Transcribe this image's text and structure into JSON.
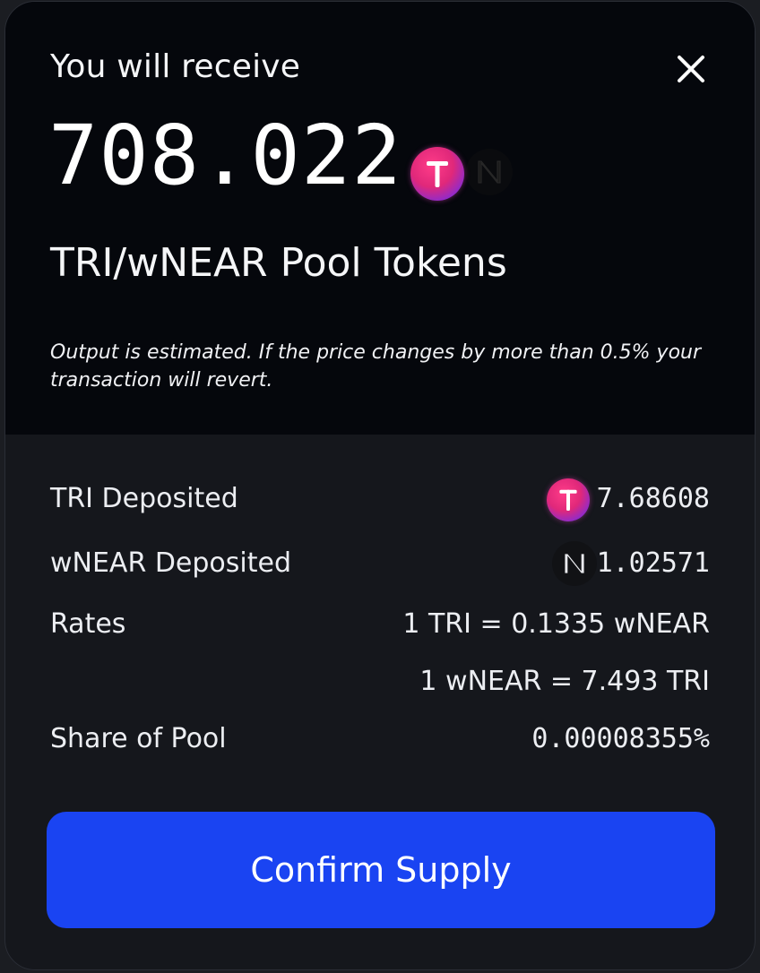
{
  "header": {
    "title": "You will receive",
    "amount": "708.022",
    "pool_name": "TRI/wNEAR Pool Tokens",
    "note": "Output is estimated. If the price changes by more than 0.5% your transaction will revert."
  },
  "details": {
    "tri_label": "TRI Deposited",
    "tri_value": "7.68608",
    "wnear_label": "wNEAR Deposited",
    "wnear_value": "1.02571",
    "rates_label": "Rates",
    "rate1": "1 TRI = 0.1335 wNEAR",
    "rate2": "1 wNEAR = 7.493 TRI",
    "share_label": "Share of Pool",
    "share_value": "0.00008355%"
  },
  "actions": {
    "confirm_label": "Confirm Supply"
  },
  "icons": {
    "close": "close-icon",
    "tri": "tri-token-icon",
    "wnear": "wnear-token-icon"
  },
  "colors": {
    "accent": "#1a44f2",
    "top_bg": "#05070c",
    "body_bg": "#15171c"
  }
}
